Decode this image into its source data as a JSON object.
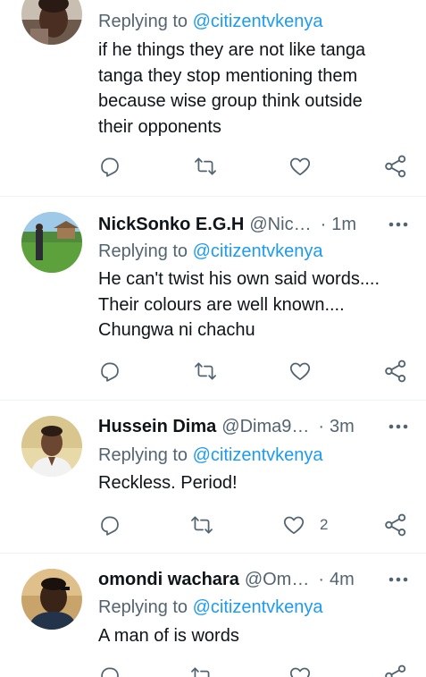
{
  "tweets": [
    {
      "name": "",
      "handle": "",
      "age": "",
      "replying_prefix": "Replying to",
      "replying_to": "@citizentvkenya",
      "text_lines": [
        "if he things they are not like tanga",
        "tanga they stop mentioning them",
        "because wise group think outside",
        "their opponents"
      ],
      "like_count": ""
    },
    {
      "name": "NickSonko E.G.H",
      "handle": "@Nic…",
      "age": "1m",
      "replying_prefix": "Replying to",
      "replying_to": "@citizentvkenya",
      "text_lines": [
        "He can't twist his own said words....",
        "Their colours are well known....",
        "Chungwa ni chachu"
      ],
      "like_count": ""
    },
    {
      "name": "Hussein Dima",
      "handle": "@Dima9…",
      "age": "3m",
      "replying_prefix": "Replying to",
      "replying_to": "@citizentvkenya",
      "text_lines": [
        "Reckless. Period!"
      ],
      "like_count": "2"
    },
    {
      "name": "omondi wachara",
      "handle": "@Om…",
      "age": "4m",
      "replying_prefix": "Replying to",
      "replying_to": "@citizentvkenya",
      "text_lines": [
        "A man of is words"
      ],
      "like_count": ""
    }
  ],
  "separator": "·",
  "icons": {
    "reply": "reply-icon",
    "retweet": "retweet-icon",
    "like": "like-icon",
    "share": "share-icon",
    "more": "more-icon"
  },
  "colors": {
    "text": "#0f1419",
    "secondary": "#536471",
    "mention": "#1d9bf0",
    "divider": "#eff3f4"
  }
}
